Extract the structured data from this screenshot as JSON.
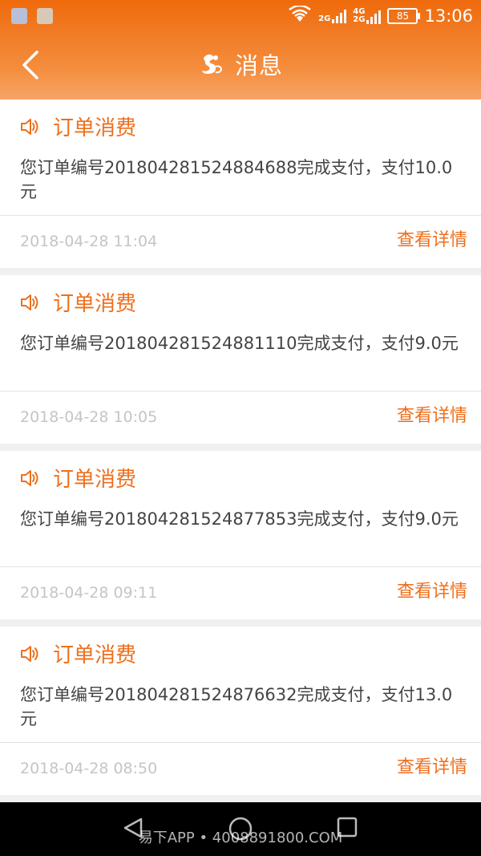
{
  "status_bar": {
    "network_top": "2G",
    "network_mid": "4G",
    "network_bottom": "2G",
    "battery": "85",
    "time": "13:06"
  },
  "header": {
    "title": "消息"
  },
  "messages": [
    {
      "type": "订单消费",
      "body": "您订单编号201804281524884688完成支付，支付10.0元",
      "time": "2018-04-28 11:04",
      "link": "查看详情"
    },
    {
      "type": "订单消费",
      "body": "您订单编号201804281524881110完成支付，支付9.0元",
      "time": "2018-04-28 10:05",
      "link": "查看详情"
    },
    {
      "type": "订单消费",
      "body": "您订单编号201804281524877853完成支付，支付9.0元",
      "time": "2018-04-28 09:11",
      "link": "查看详情"
    },
    {
      "type": "订单消费",
      "body": "您订单编号201804281524876632完成支付，支付13.0元",
      "time": "2018-04-28 08:50",
      "link": "查看详情"
    }
  ],
  "footer": {
    "watermark": "易下APP • 4008891800.COM"
  },
  "colors": {
    "accent": "#ee6f1d",
    "header_top": "#ef6a0c",
    "header_bottom": "#f7a468"
  },
  "icons": {
    "back": "chevron-left-icon",
    "logo": "dragon-logo-icon",
    "speaker": "speaker-icon",
    "wifi": "wifi-icon",
    "signal": "signal-icon",
    "battery": "battery-icon"
  }
}
